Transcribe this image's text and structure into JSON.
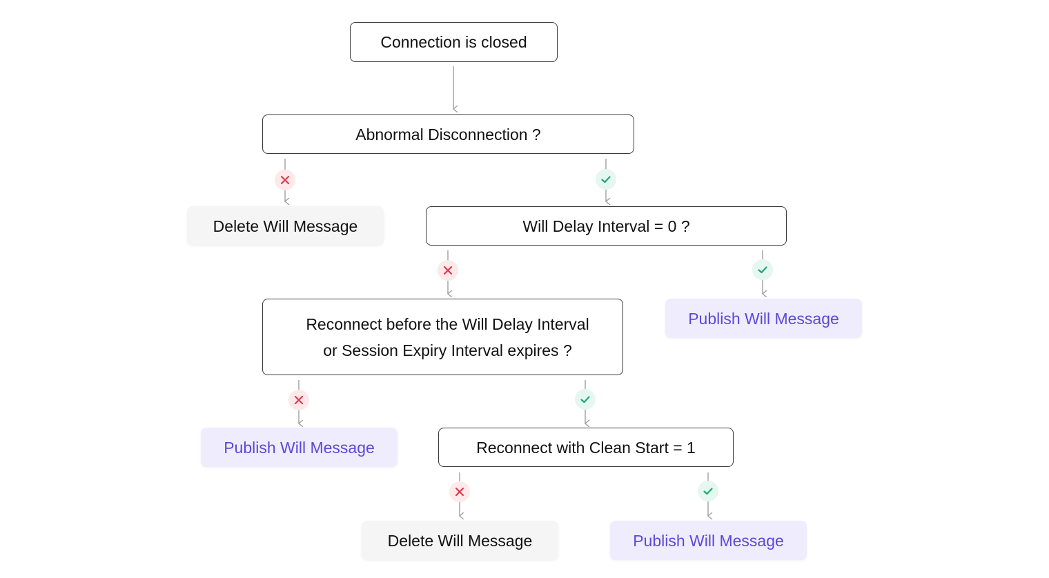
{
  "diagram": {
    "nodes": {
      "start": "Connection is closed",
      "abnormal": "Abnormal Disconnection ?",
      "delete_1": "Delete Will Message",
      "will_delay": "Will Delay Interval = 0 ?",
      "publish_1": "Publish Will Message",
      "reconnect_before_line1": "Reconnect before the Will Delay Interval",
      "reconnect_before_line2": "or Session Expiry Interval expires ?",
      "publish_2": "Publish Will Message",
      "clean_start": "Reconnect with Clean Start = 1",
      "delete_2": "Delete Will Message",
      "publish_3": "Publish Will Message"
    },
    "edges": [
      {
        "from": "start",
        "to": "abnormal",
        "label": "none"
      },
      {
        "from": "abnormal",
        "to": "delete_1",
        "label": "no"
      },
      {
        "from": "abnormal",
        "to": "will_delay",
        "label": "yes"
      },
      {
        "from": "will_delay",
        "to": "reconnect_before",
        "label": "no"
      },
      {
        "from": "will_delay",
        "to": "publish_1",
        "label": "yes"
      },
      {
        "from": "reconnect_before",
        "to": "publish_2",
        "label": "no"
      },
      {
        "from": "reconnect_before",
        "to": "clean_start",
        "label": "yes"
      },
      {
        "from": "clean_start",
        "to": "delete_2",
        "label": "no"
      },
      {
        "from": "clean_start",
        "to": "publish_3",
        "label": "yes"
      }
    ],
    "icons": {
      "no": "cross-icon",
      "yes": "check-icon"
    },
    "colors": {
      "no": "#e0394b",
      "no_bg": "#fde8ea",
      "yes": "#1aa874",
      "yes_bg": "#e5f7f0",
      "publish_text": "#5a49d9",
      "publish_bg": "#efedfd",
      "delete_bg": "#f5f5f5",
      "connector": "#a0a0a0"
    }
  }
}
